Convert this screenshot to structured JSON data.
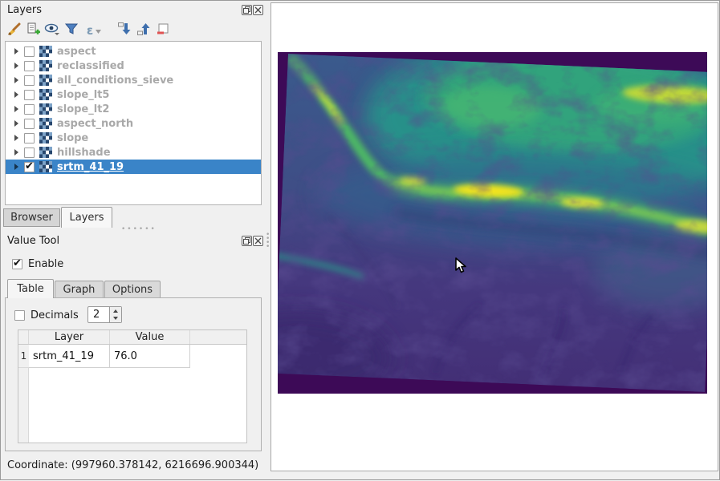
{
  "layers_panel": {
    "title": "Layers",
    "toolbar": {
      "styling": "open-layer-styling",
      "add_group": "add-group",
      "manage_themes": "manage-map-themes",
      "filter_legend": "filter-legend",
      "filter_expression": "filter-legend-by-expression",
      "expand_all": "expand-all",
      "collapse_all": "collapse-all",
      "remove": "remove-layer-group"
    },
    "items": [
      {
        "label": "aspect",
        "checked": false,
        "selected": false
      },
      {
        "label": "reclassified",
        "checked": false,
        "selected": false
      },
      {
        "label": "all_conditions_sieve",
        "checked": false,
        "selected": false
      },
      {
        "label": "slope_lt5",
        "checked": false,
        "selected": false
      },
      {
        "label": "slope_lt2",
        "checked": false,
        "selected": false
      },
      {
        "label": "aspect_north",
        "checked": false,
        "selected": false
      },
      {
        "label": "slope",
        "checked": false,
        "selected": false
      },
      {
        "label": "hillshade",
        "checked": false,
        "selected": false
      },
      {
        "label": "srtm_41_19",
        "checked": true,
        "selected": true
      }
    ]
  },
  "dock_tabs": {
    "tabs": [
      "Browser",
      "Layers"
    ],
    "active": "Layers"
  },
  "value_tool": {
    "title": "Value Tool",
    "enable_label": "Enable",
    "enable_checked": true,
    "tabs": [
      "Table",
      "Graph",
      "Options"
    ],
    "active_tab": "Table",
    "decimals_label": "Decimals",
    "decimals_checked": false,
    "decimals_value": "2",
    "table": {
      "columns": [
        "Layer",
        "Value"
      ],
      "rows": [
        {
          "num": "1",
          "layer": "srtm_41_19",
          "value": "76.0"
        }
      ]
    }
  },
  "statusbar": {
    "coordinate": "Coordinate: (997960.378142, 6216696.900344)"
  },
  "map": {
    "layer_shown": "srtm_41_19",
    "colors": {
      "nodata_purple": "#3d0a57",
      "low_purple": "#44317b",
      "mid_blue": "#3b528b",
      "teal": "#27948a",
      "green": "#44bf70",
      "bright_yellow": "#fde725",
      "selection_blue": "#3a84c8",
      "canvas_white": "#ffffff"
    }
  }
}
